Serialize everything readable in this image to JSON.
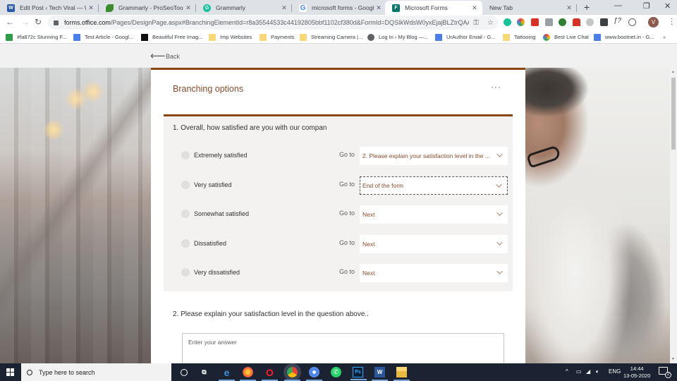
{
  "browser": {
    "tabs": [
      {
        "title": "Edit Post ‹ Tech Viral — WordPress",
        "favicon": "wordpress-icon",
        "color": "#2d5aa8",
        "active": false
      },
      {
        "title": "Grammarly - ProSeoTools_",
        "favicon": "proseotools-icon",
        "color": "#3a8c2e",
        "active": false
      },
      {
        "title": "Grammarly",
        "favicon": "grammarly-icon",
        "color": "#15c39a",
        "active": false
      },
      {
        "title": "microsoft forms - Google Search",
        "favicon": "google-icon",
        "color": "#4285f4",
        "active": false
      },
      {
        "title": "Microsoft Forms",
        "favicon": "forms-icon",
        "color": "#077568",
        "active": true
      },
      {
        "title": "New Tab",
        "favicon": "",
        "color": "",
        "active": false
      }
    ],
    "new_tab_label": "+",
    "window_controls": {
      "minimize": "—",
      "maximize": "❐",
      "close": "✕"
    },
    "url_domain": "forms.office.com",
    "url_path": "/Pages/DesignPage.aspx#BranchingElementId=r8a35544533c44192805bbf1102cf380d&FormId=DQSIkWdsW0yxEjajBLZtrQAAAA...",
    "profile_initial": "V",
    "bookmarks": [
      {
        "label": "#fa872c Stunning F...",
        "icon": "colorhexa-icon"
      },
      {
        "label": "Test Article - Googl...",
        "icon": "google-docs-icon"
      },
      {
        "label": "Beautiful Free Imag...",
        "icon": "unsplash-icon"
      },
      {
        "label": "Imp Websites",
        "icon": "folder-icon"
      },
      {
        "label": "Payments",
        "icon": "folder-icon"
      },
      {
        "label": "Streaming Camera |...",
        "icon": "folder-icon"
      },
      {
        "label": "Log In ‹ My Blog —...",
        "icon": "globe-icon"
      },
      {
        "label": "UrAuthor Email - G...",
        "icon": "google-docs-icon"
      },
      {
        "label": "Tattooing",
        "icon": "folder-icon"
      },
      {
        "label": "Best Live Chat",
        "icon": "livechat-icon"
      },
      {
        "label": "www.bootnet.in - G...",
        "icon": "google-docs-icon"
      }
    ],
    "bookmarks_overflow": "»"
  },
  "page": {
    "back_label": "Back",
    "card_title": "Branching options",
    "more_label": "···",
    "question1": {
      "title": "1. Overall, how satisfied are you with our compan",
      "goto_label": "Go to",
      "options": [
        {
          "label": "Extremely satisfied",
          "goto": "2. Please explain your satisfaction level in the ...",
          "focused": false
        },
        {
          "label": "Very satisfied",
          "goto": "End of the form",
          "focused": true
        },
        {
          "label": "Somewhat satisfied",
          "goto": "Next",
          "focused": false
        },
        {
          "label": "Dissatisfied",
          "goto": "Next",
          "focused": false
        },
        {
          "label": "Very dissatisfied",
          "goto": "Next",
          "focused": false
        }
      ]
    },
    "question2": {
      "title": "2. Please explain your satisfaction level in the question above..",
      "placeholder": "Enter your answer"
    },
    "accent_color": "#8b4513"
  },
  "taskbar": {
    "search_placeholder": "Type here to search",
    "apps": [
      "cortana-icon",
      "task-view-icon",
      "edge-icon",
      "firefox-icon",
      "opera-icon",
      "chrome-icon",
      "chromium-icon",
      "whatsapp-icon",
      "photoshop-icon",
      "word-icon",
      "file-explorer-icon"
    ],
    "language": "ENG",
    "time": "14:44",
    "date": "13-05-2020",
    "notification_count": "2"
  }
}
